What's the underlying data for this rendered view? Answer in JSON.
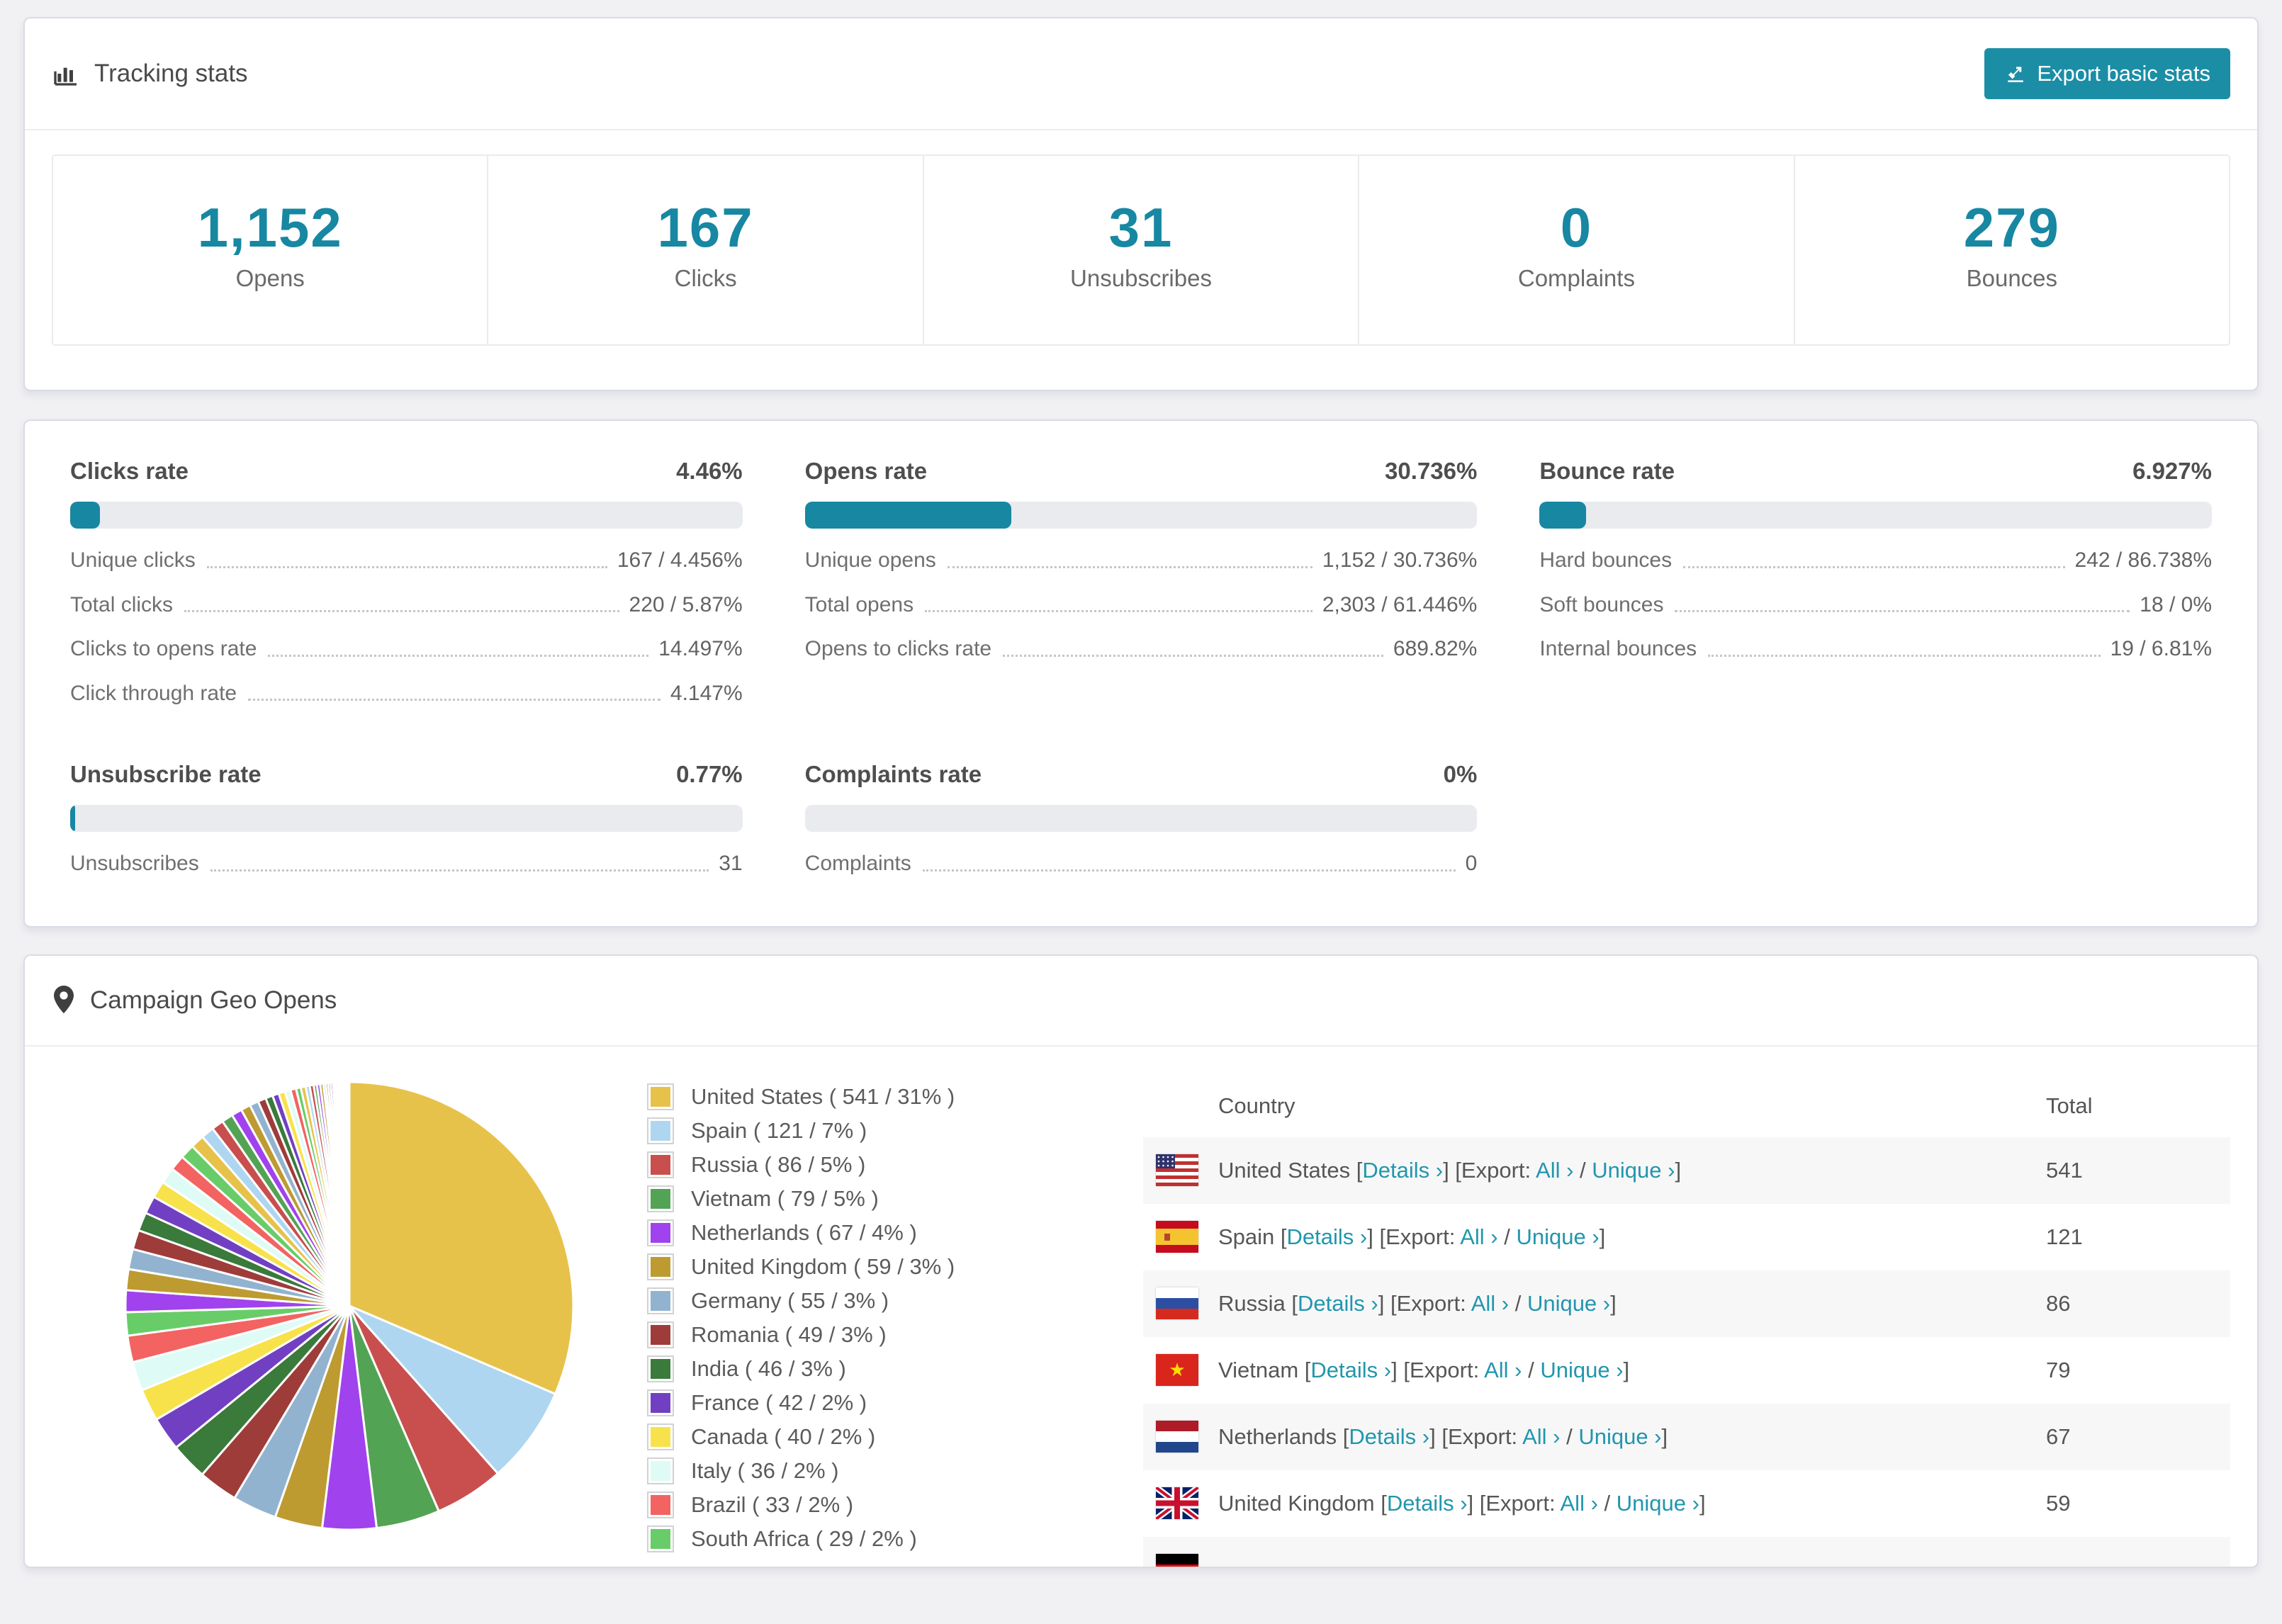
{
  "accent_color": "#1787a2",
  "header": {
    "title": "Tracking stats",
    "export_button_label": "Export basic stats"
  },
  "summary_stats": [
    {
      "value": "1,152",
      "label": "Opens"
    },
    {
      "value": "167",
      "label": "Clicks"
    },
    {
      "value": "31",
      "label": "Unsubscribes"
    },
    {
      "value": "0",
      "label": "Complaints"
    },
    {
      "value": "279",
      "label": "Bounces"
    }
  ],
  "rates": [
    {
      "title": "Clicks rate",
      "value": "4.46%",
      "percent": 4.46,
      "rows": [
        {
          "label": "Unique clicks",
          "value": "167 / 4.456%"
        },
        {
          "label": "Total clicks",
          "value": "220 / 5.87%"
        },
        {
          "label": "Clicks to opens rate",
          "value": "14.497%"
        },
        {
          "label": "Click through rate",
          "value": "4.147%"
        }
      ]
    },
    {
      "title": "Opens rate",
      "value": "30.736%",
      "percent": 30.736,
      "rows": [
        {
          "label": "Unique opens",
          "value": "1,152 / 30.736%"
        },
        {
          "label": "Total opens",
          "value": "2,303 / 61.446%"
        },
        {
          "label": "Opens to clicks rate",
          "value": "689.82%"
        }
      ]
    },
    {
      "title": "Bounce rate",
      "value": "6.927%",
      "percent": 6.927,
      "rows": [
        {
          "label": "Hard bounces",
          "value": "242 / 86.738%"
        },
        {
          "label": "Soft bounces",
          "value": "18 / 0%"
        },
        {
          "label": "Internal bounces",
          "value": "19 / 6.81%"
        }
      ]
    },
    {
      "title": "Unsubscribe rate",
      "value": "0.77%",
      "percent": 0.77,
      "rows": [
        {
          "label": "Unsubscribes",
          "value": "31"
        }
      ]
    },
    {
      "title": "Complaints rate",
      "value": "0%",
      "percent": 0,
      "rows": [
        {
          "label": "Complaints",
          "value": "0"
        }
      ]
    }
  ],
  "geo": {
    "title": "Campaign Geo Opens",
    "legend_format": "{name} ( {count} / {pct}% )",
    "table": {
      "headers": {
        "country": "Country",
        "total": "Total"
      },
      "labels": {
        "bracket_open": "[",
        "bracket_close": "]",
        "details": "Details ›",
        "export_prefix": "[Export:",
        "all": "All ›",
        "separator": "/",
        "unique": "Unique ›"
      },
      "rows": [
        {
          "flag": "us",
          "country": "United States",
          "total": "541"
        },
        {
          "flag": "es",
          "country": "Spain",
          "total": "121"
        },
        {
          "flag": "ru",
          "country": "Russia",
          "total": "86"
        },
        {
          "flag": "vn",
          "country": "Vietnam",
          "total": "79"
        },
        {
          "flag": "nl",
          "country": "Netherlands",
          "total": "67"
        },
        {
          "flag": "gb",
          "country": "United Kingdom",
          "total": "59"
        }
      ],
      "partial_row": {
        "flag": "de"
      }
    }
  },
  "chart_data": {
    "type": "pie",
    "title": "Campaign Geo Opens",
    "legend_position": "right",
    "start_angle_deg": 0,
    "direction": "clockwise",
    "labels": [
      "United States",
      "Spain",
      "Russia",
      "Vietnam",
      "Netherlands",
      "United Kingdom",
      "Germany",
      "Romania",
      "India",
      "France",
      "Canada",
      "Italy",
      "Brazil",
      "South Africa"
    ],
    "values": [
      541,
      121,
      86,
      79,
      67,
      59,
      55,
      49,
      46,
      42,
      40,
      36,
      33,
      29
    ],
    "percent_labels": [
      31,
      7,
      5,
      5,
      4,
      3,
      3,
      3,
      3,
      2,
      2,
      2,
      2,
      2
    ],
    "colors": [
      "#e7c24a",
      "#aed6f0",
      "#c84f4e",
      "#53a355",
      "#a042ee",
      "#bd9b31",
      "#92b3cf",
      "#9e3c3a",
      "#3a7a3b",
      "#7140c2",
      "#f8e24b",
      "#dffbf5",
      "#f26361",
      "#68cd68"
    ],
    "unlabeled_tail_values": [
      27,
      26,
      25,
      24,
      23,
      22,
      21,
      20,
      19,
      18,
      17,
      16,
      15,
      14,
      13,
      12,
      11,
      10,
      9,
      8,
      8,
      7,
      7,
      6,
      6,
      5,
      5,
      4,
      4,
      4,
      3,
      3,
      3,
      3,
      2,
      2,
      2,
      2,
      2,
      2,
      1,
      1,
      1,
      1,
      1,
      1,
      1,
      1
    ]
  }
}
